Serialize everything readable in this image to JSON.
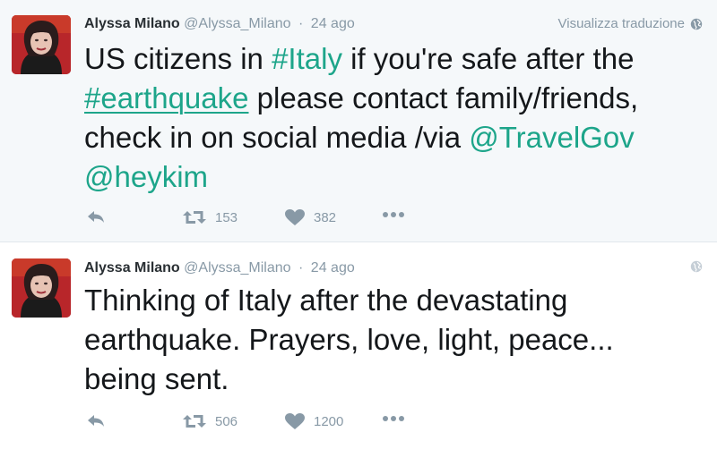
{
  "tweets": [
    {
      "author_name": "Alyssa Milano",
      "handle": "@Alyssa_Milano",
      "separator": "·",
      "time": "24 ago",
      "translate_label": "Visualizza traduzione",
      "text_segments": [
        {
          "text": "US citizens in ",
          "type": "plain"
        },
        {
          "text": "#Italy",
          "type": "hashtag"
        },
        {
          "text": " if you're safe after the",
          "type": "plain"
        },
        {
          "text": "#earthquake",
          "type": "hashtag-underlined"
        },
        {
          "text": " please contact family/friends,",
          "type": "plain"
        },
        {
          "text": "check in on social media /via ",
          "type": "plain"
        },
        {
          "text": "@TravelGov",
          "type": "mention"
        },
        {
          "text": "@heykim",
          "type": "mention"
        }
      ],
      "retweet_count": "153",
      "like_count": "382"
    },
    {
      "author_name": "Alyssa Milano",
      "handle": "@Alyssa_Milano",
      "separator": "·",
      "time": "24 ago",
      "text_lines": [
        "Thinking of Italy after the devastating",
        "earthquake. Prayers, love, light, peace...",
        "being sent."
      ],
      "retweet_count": "506",
      "like_count": "1200"
    }
  ],
  "colors": {
    "link": "#1da58a",
    "muted": "#8899a6",
    "tweet1_bg": "#f5f8fa",
    "avatar_bg": "#b8262a"
  },
  "icons": [
    "reply-icon",
    "retweet-icon",
    "heart-icon",
    "more-icon",
    "globe-icon"
  ]
}
